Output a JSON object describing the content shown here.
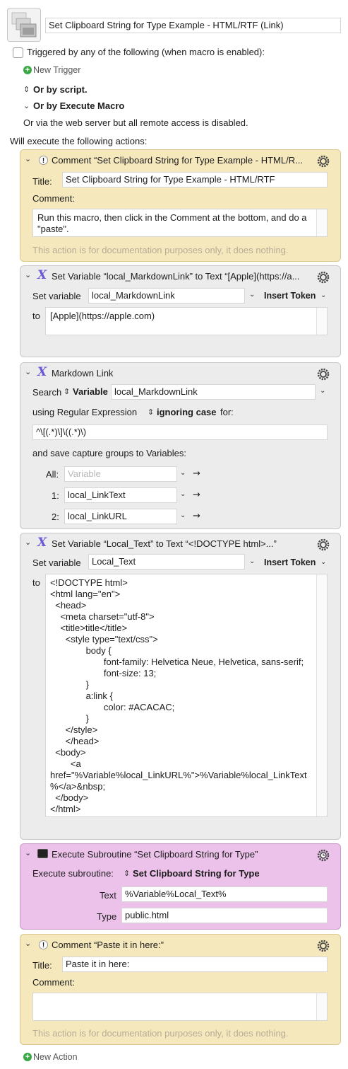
{
  "macro": {
    "name": "Set Clipboard String for Type Example - HTML/RTF (Link)",
    "triggered_label": "Triggered by any of the following (when macro is enabled):",
    "new_trigger": "New Trigger",
    "or_by_script": "Or by script.",
    "or_by_execute_macro": "Or by Execute Macro",
    "web_server_note": "Or via the web server but all remote access is disabled.",
    "will_execute": "Will execute the following actions:",
    "new_action": "New Action"
  },
  "actions": [
    {
      "type": "comment",
      "header": "Comment “Set Clipboard String for Type Example - HTML/R...",
      "title_label": "Title:",
      "title_value": "Set Clipboard String for Type Example - HTML/RTF",
      "comment_label": "Comment:",
      "comment_value": "Run this macro, then click in the Comment at the bottom, and do a \"paste\".",
      "footer": "This action is for documentation purposes only, it does nothing."
    },
    {
      "type": "set_variable",
      "header": "Set Variable “local_MarkdownLink” to Text “[Apple](https://a...",
      "set_label": "Set variable",
      "variable": "local_MarkdownLink",
      "insert_token": "Insert Token",
      "to_label": "to",
      "text": "[Apple](https://apple.com)"
    },
    {
      "type": "search",
      "header": "Markdown Link",
      "search_label": "Search",
      "search_mode": "Variable",
      "search_variable": "local_MarkdownLink",
      "using_label": "using Regular Expression",
      "case_mode": "ignoring case",
      "for_label": "for:",
      "regex": "^\\[(.*)\\]\\((.*)\\)",
      "save_label": "and save capture groups to Variables:",
      "groups": [
        {
          "label": "All:",
          "value": "",
          "placeholder": "Variable"
        },
        {
          "label": "1:",
          "value": "local_LinkText"
        },
        {
          "label": "2:",
          "value": "local_LinkURL"
        }
      ]
    },
    {
      "type": "set_variable",
      "header": "Set Variable “Local_Text” to Text “<!DOCTYPE html>...”",
      "set_label": "Set variable",
      "variable": "Local_Text",
      "insert_token": "Insert Token",
      "to_label": "to",
      "text": "<!DOCTYPE html>\n<html lang=\"en\">\n  <head>\n    <meta charset=\"utf-8\">\n    <title>title</title>\n      <style type=\"text/css\">\n              body {\n                     font-family: Helvetica Neue, Helvetica, sans-serif;\n                     font-size: 13;\n              }\n              a:link {\n                     color: #ACACAC;\n              }\n      </style>\n      </head>\n  <body>\n        <a\nhref=\"%Variable%local_LinkURL%\">%Variable%local_LinkText\n%</a>&nbsp;\n  </body>\n</html>"
    },
    {
      "type": "subroutine",
      "header": "Execute Subroutine “Set Clipboard String for Type”",
      "exec_label": "Execute subroutine:",
      "subroutine": "Set Clipboard String for Type",
      "params": [
        {
          "label": "Text",
          "value": "%Variable%Local_Text%"
        },
        {
          "label": "Type",
          "value": "public.html"
        }
      ]
    },
    {
      "type": "comment",
      "header": "Comment “Paste it in here:”",
      "title_label": "Title:",
      "title_value": "Paste it in here:",
      "comment_label": "Comment:",
      "comment_value": "",
      "footer": "This action is for documentation purposes only, it does nothing."
    }
  ],
  "colors": {
    "comment_bg": "#f5e8bd",
    "action_bg": "#ececec",
    "subroutine_bg": "#ecc2ea",
    "variable_icon": "#6b5ad6",
    "add_icon": "#3aa845"
  },
  "icons": {
    "macro_icon": "stacked-windows-icon",
    "gear": "gear-icon",
    "gear_clock": "gear-clock-icon",
    "variable": "x-variable-icon",
    "comment": "exclamation-icon",
    "subroutine": "terminal-window-icon",
    "add": "plus-circle-icon"
  }
}
